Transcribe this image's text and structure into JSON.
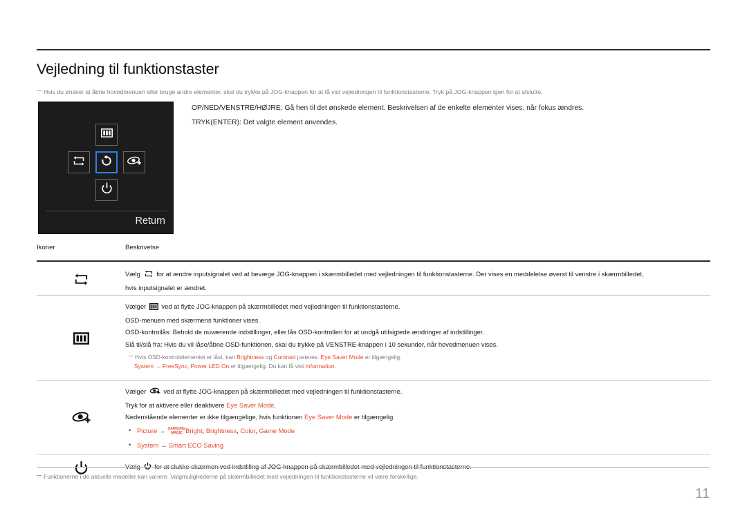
{
  "document": {
    "title": "Vejledning til funktionstaster",
    "page_number": "11",
    "top_note": "Hvis du ønsker at åbne hovedmenuen eller bruge andre elementer, skal du trykke på JOG-knappen for at få vist vejledningen til funktionstasterne. Tryk på JOG-knappen igen for at afslutte.",
    "footer_note": "Funktionerne i de aktuelle modeller kan variere. Valgmulighederne på skærmbilledet med vejledningen til funktionstasterne vil være forskellige."
  },
  "intro": {
    "line1": "OP/NED/VENSTRE/HØJRE: Gå hen til det ønskede element. Beskrivelsen af de enkelte elementer vises, når fokus ændres.",
    "line2": "TRYK(ENTER): Det valgte element anvendes."
  },
  "osd": {
    "return_label": "Return",
    "keys": {
      "up": "menu-icon",
      "left": "input-source-icon",
      "center": "return-icon",
      "right": "eye-saver-icon",
      "down": "power-icon"
    },
    "highlight_color": "#2f7fe8",
    "background_color": "#1c1c1c"
  },
  "table": {
    "headers": {
      "icons": "Ikoner",
      "description": "Beskrivelse"
    },
    "rows": [
      {
        "icon": "input-source-icon",
        "lines": [
          {
            "pre": "Vælg ",
            "icon": "input-source-icon",
            "post": " for at ændre inputsignalet ved at bevæge JOG-knappen i skærmbilledet med vejledningen til funktionstasterne. Der vises en meddelelse øverst til venstre i skærmbilledet,"
          },
          {
            "text": "hvis inputsignalet er ændret."
          }
        ]
      },
      {
        "icon": "menu-icon",
        "lines": [
          {
            "pre": "Vælger ",
            "icon": "menu-icon",
            "post": " ved at flytte JOG-knappen på skærmbilledet med vejledningen til funktionstasterne."
          },
          {
            "text": "OSD-menuen med skærmens funktioner vises."
          },
          {
            "text": "OSD-kontrollås: Behold de nuværende indstillinger, eller lås OSD-kontrollen for at undgå utilsigtede ændringer af indstillinger."
          },
          {
            "text": "Slå til/slå fra: Hvis du vil låse/åbne OSD-funktionen, skal du trykke på VENSTRE-knappen i 10 sekunder, når hovedmenuen vises."
          }
        ],
        "note": {
          "line1_a": "Hvis OSD-kontrolelementet er låst, kan ",
          "line1_l1": "Brightness",
          "line1_b": " og ",
          "line1_l2": "Contrast",
          "line1_c": " justeres. ",
          "line1_l3": "Eye Saver Mode",
          "line1_d": " er tilgængelig.",
          "line2_l1": "System",
          "line2_a": " → ",
          "line2_l2": "FreeSync",
          "line2_b": ", ",
          "line2_l3": "Power LED On",
          "line2_c": " er tilgængelig. Du kan få vist ",
          "line2_l4": "Information",
          "line2_d": "."
        }
      },
      {
        "icon": "eye-saver-icon",
        "lines": [
          {
            "pre": "Vælger ",
            "icon": "eye-saver-icon",
            "post": " ved at flytte JOG-knappen på skærmbilledet med vejledningen til funktionstasterne."
          },
          {
            "pre": "Tryk for at aktivere eller deaktivere ",
            "link": "Eye Saver Mode",
            "post": "."
          },
          {
            "pre": "Nedenstående elementer er ikke tilgængelige, hvis funktionen ",
            "link": "Eye Saver Mode",
            "post": " er tilgængelig."
          }
        ],
        "bullets": [
          {
            "l1": "Picture",
            "arrow": " → ",
            "logo_top": "SAMSUNG",
            "logo_bottom": "MAGIC",
            "l2": "Bright",
            "sep1": ", ",
            "l3": "Brightness",
            "sep2": ", ",
            "l4": "Color",
            "sep3": ", ",
            "l5": "Game Mode"
          },
          {
            "l1": "System",
            "arrow": " → ",
            "l2": "Smart ECO Saving"
          }
        ]
      },
      {
        "icon": "power-icon",
        "lines": [
          {
            "pre": "Vælg ",
            "icon": "power-icon",
            "post": " for at slukke skærmen ved indstilling af JOG-knappen på skærmbilledet med vejledningen til funktionstasterne."
          }
        ]
      }
    ]
  },
  "colors": {
    "link": "#e8492c",
    "note_text": "#7d7d7d",
    "rule": "#2b2b2b"
  }
}
